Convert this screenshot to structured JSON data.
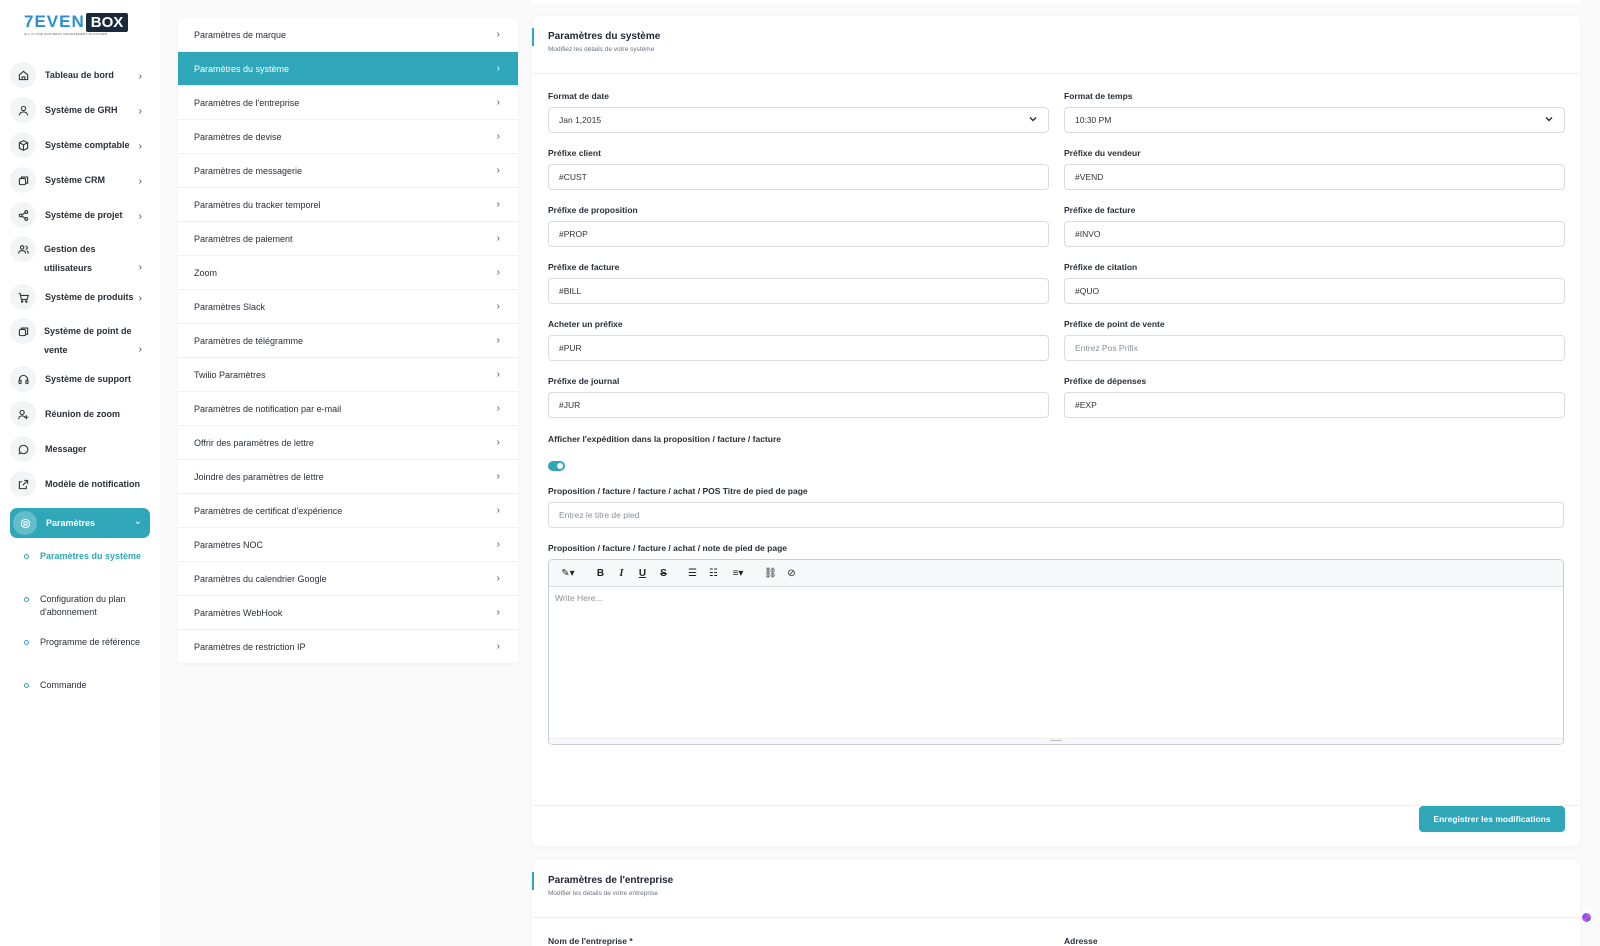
{
  "brand": {
    "logo_word": "7EVEN",
    "logo_box": "BOX",
    "tagline": "ALL IN ONE BUSINESS MANAGEMENT PLATFORM"
  },
  "sidebar": {
    "items": [
      {
        "label": "Tableau de bord",
        "icon": "home-icon"
      },
      {
        "label": "Système de GRH",
        "icon": "user-icon"
      },
      {
        "label": "Système comptable",
        "icon": "box-icon"
      },
      {
        "label": "Système CRM",
        "icon": "layers-icon"
      },
      {
        "label": "Système de projet",
        "icon": "share-icon"
      },
      {
        "label": "Gestion des utilisateurs",
        "icon": "users-icon"
      },
      {
        "label": "Système de produits",
        "icon": "cart-icon"
      },
      {
        "label": "Système de point de vente",
        "icon": "layers-icon"
      },
      {
        "label": "Système de support",
        "icon": "headset-icon"
      },
      {
        "label": "Réunion de zoom",
        "icon": "user-plus-icon"
      },
      {
        "label": "Messager",
        "icon": "message-icon"
      },
      {
        "label": "Modèle de notification",
        "icon": "external-icon"
      },
      {
        "label": "Paramètres",
        "icon": "gear-icon"
      }
    ],
    "subitems": [
      {
        "label": "Paramètres du système"
      },
      {
        "label": "Configuration du plan d'abonnement"
      },
      {
        "label": "Programme de référence"
      },
      {
        "label": "Commande"
      }
    ]
  },
  "settings_menu": [
    "Paramètres de marque",
    "Paramètres du système",
    "Paramètres de l'entreprise",
    "Paramètres de devise",
    "Paramètres de messagerie",
    "Paramètres du tracker temporel",
    "Paramètres de paiement",
    "Zoom",
    "Paramètres Slack",
    "Paramètres de télégramme",
    "Twilio Paramètres",
    "Paramètres de notification par e-mail",
    "Offrir des paramètres de lettre",
    "Joindre des paramètres de lettre",
    "Paramètres de certificat d'expérience",
    "Paramètres NOC",
    "Paramètres du calendrier Google",
    "Paramètres WebHook",
    "Paramètres de restriction IP"
  ],
  "system_card": {
    "title": "Paramètres du système",
    "subtitle": "Modifiez les détails de votre système",
    "date_format": {
      "label": "Format de date",
      "value": "Jan 1,2015"
    },
    "time_format": {
      "label": "Format de temps",
      "value": "10:30 PM"
    },
    "fields": [
      {
        "label": "Préfixe client",
        "value": "#CUST",
        "placeholder": ""
      },
      {
        "label": "Préfixe du vendeur",
        "value": "#VEND",
        "placeholder": ""
      },
      {
        "label": "Préfixe de proposition",
        "value": "#PROP",
        "placeholder": ""
      },
      {
        "label": "Préfixe de facture",
        "value": "#INVO",
        "placeholder": ""
      },
      {
        "label": "Préfixe de facture",
        "value": "#BILL",
        "placeholder": ""
      },
      {
        "label": "Préfixe de citation",
        "value": "#QUO",
        "placeholder": ""
      },
      {
        "label": "Acheter un préfixe",
        "value": "#PUR",
        "placeholder": ""
      },
      {
        "label": "Préfixe de point de vente",
        "value": "",
        "placeholder": "Entrez Pos Prifix"
      },
      {
        "label": "Préfixe de journal",
        "value": "#JUR",
        "placeholder": ""
      },
      {
        "label": "Préfixe de dépenses",
        "value": "#EXP",
        "placeholder": ""
      }
    ],
    "shipping_toggle": {
      "label": "Afficher l'expédition dans la proposition / facture / facture",
      "on": true
    },
    "footer_title": {
      "label": "Proposition / facture / facture / achat / POS Titre de pied de page",
      "value": "",
      "placeholder": "Entrez le titre de pied"
    },
    "footer_note": {
      "label": "Proposition / facture / facture / achat / note de pied de page",
      "placeholder": "Write Here..."
    },
    "save_label": "Enregistrer les modifications"
  },
  "company_card": {
    "title": "Paramètres de l'entreprise",
    "subtitle": "Modifier les détails de votre entreprise",
    "name_label": "Nom de l'entreprise *",
    "address_label": "Adresse"
  },
  "colors": {
    "accent": "#2fa7b9",
    "text": "#1e2533",
    "background": "#fafafb"
  }
}
